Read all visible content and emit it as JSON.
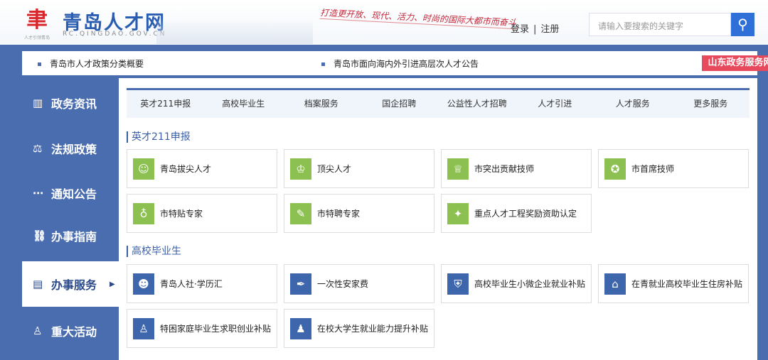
{
  "header": {
    "logo_title": "青岛人才网",
    "logo_url": "RC.QINGDAO.GOV.CN",
    "logo_sub": "人才引领青岛",
    "slogan": "打造更开放、现代、活力、时尚的国际大都市而奋斗",
    "login": "登录",
    "separator": "|",
    "register": "注册",
    "search_placeholder": "请输入要搜索的关键字"
  },
  "notices": [
    "青岛市人才政策分类概要",
    "青岛市面向海内外引进高层次人才公告"
  ],
  "badge": "山东政务服务网",
  "sidebar": [
    {
      "label": "政务资讯",
      "icon": "building-icon"
    },
    {
      "label": "法规政策",
      "icon": "scale-icon"
    },
    {
      "label": "通知公告",
      "icon": "chat-icon"
    },
    {
      "label": "办事指南",
      "icon": "guide-icon"
    },
    {
      "label": "办事服务",
      "icon": "document-icon",
      "active": true
    },
    {
      "label": "重大活动",
      "icon": "trophy-icon"
    }
  ],
  "tabs": [
    "英才211申报",
    "高校毕业生",
    "档案服务",
    "国企招聘",
    "公益性人才招聘",
    "人才引进",
    "人才服务",
    "更多服务"
  ],
  "sections": [
    {
      "title": "英才211申报",
      "items": [
        "青岛拔尖人才",
        "顶尖人才",
        "市突出贡献技师",
        "市首席技师",
        "市特贴专家",
        "市特聘专家",
        "重点人才工程奖励资助认定"
      ]
    },
    {
      "title": "高校毕业生",
      "items": [
        "青岛人社·学历汇",
        "一次性安家费",
        "高校毕业生小微企业就业补贴",
        "在青就业高校毕业生住房补贴",
        "特困家庭毕业生求职创业补贴",
        "在校大学生就业能力提升补贴"
      ]
    }
  ],
  "colors": {
    "brand": "#4a6db0",
    "green": "#8cc152",
    "badge": "#e64a5c"
  }
}
